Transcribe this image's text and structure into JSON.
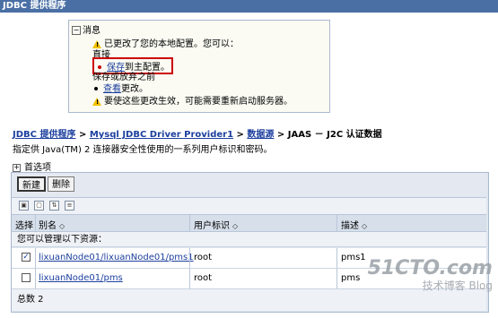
{
  "window": {
    "title": "JDBC 提供程序"
  },
  "messages": {
    "header": "消息",
    "changed_text": "已更改了您的本地配置。您可以：",
    "direct_label": "直接",
    "save_link": "保存",
    "save_suffix": "到主配置。",
    "save_or_discard_label": "保存或放弃之前",
    "review_link": "查看",
    "review_suffix": "更改。",
    "restart_text": "要使这些更改生效，可能需要重新启动服务器。"
  },
  "breadcrumb": {
    "item1": "JDBC 提供程序",
    "sep": ">",
    "item2": "Mysql JDBC Driver Provider1",
    "item3": "数据源",
    "item4": "JAAS － J2C 认证数据"
  },
  "description": "指定供 Java(TM) 2 连接器安全性使用的一系列用户标识和密码。",
  "preferences_label": "首选项",
  "toolbar": {
    "new_label": "新建",
    "delete_label": "删除"
  },
  "table": {
    "headers": {
      "select": "选择",
      "alias": "别名",
      "user_id": "用户标识",
      "description": "描述"
    },
    "manage_text": "您可以管理以下资源：",
    "rows": [
      {
        "alias": "lixuanNode01/lixuanNode01/pms1",
        "user": "root",
        "description": "pms1",
        "checked": true
      },
      {
        "alias": "lixuanNode01/pms",
        "user": "root",
        "description": "pms",
        "checked": false
      }
    ],
    "total_text": "总数 2"
  },
  "watermark": {
    "line1": "51CTO.com",
    "line2": "技术博客",
    "line3": "Blog"
  }
}
